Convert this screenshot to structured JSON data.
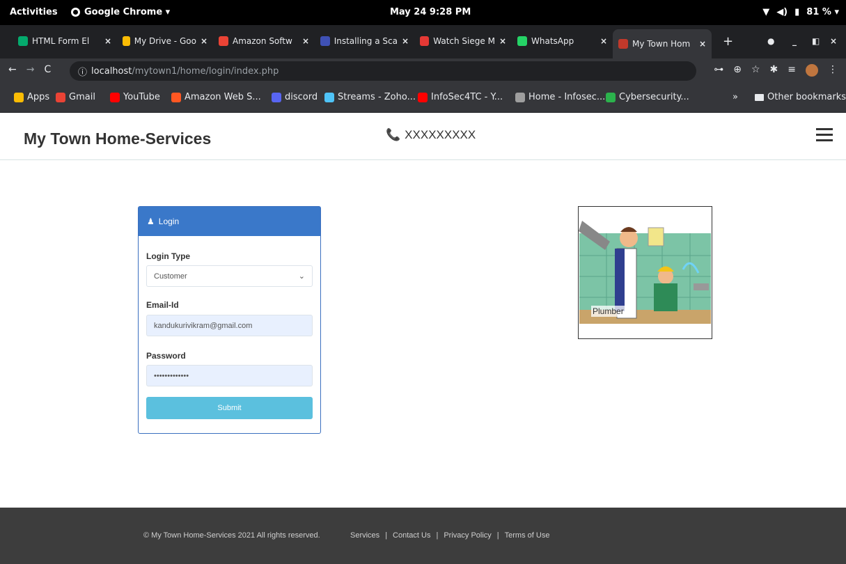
{
  "os_bar": {
    "activities": "Activities",
    "app_name": "Google Chrome ▾",
    "clock": "May 24  9:28 PM",
    "battery": "81 % ▾"
  },
  "browser": {
    "tabs": [
      {
        "label": "HTML Form El",
        "icon": "w3schools-icon",
        "color": "#04aa6d"
      },
      {
        "label": "My Drive - Goo",
        "icon": "drive-icon",
        "color": "#fbbc04"
      },
      {
        "label": "Amazon Softw",
        "icon": "gmail-icon",
        "color": "#ea4335"
      },
      {
        "label": "Installing a Sca",
        "icon": "shield-icon",
        "color": "#3f51b5"
      },
      {
        "label": "Watch Siege M",
        "icon": "red-x-icon",
        "color": "#e53935"
      },
      {
        "label": "WhatsApp",
        "icon": "whatsapp-icon",
        "color": "#25d366"
      },
      {
        "label": "My Town Hom",
        "icon": "site-icon",
        "color": "#c0392b"
      }
    ],
    "url_host": "localhost",
    "url_path": "/mytown1/home/login/index.php",
    "bookmarks": [
      {
        "label": "Apps",
        "icon": "apps-grid-icon",
        "color": "#fbbc04"
      },
      {
        "label": "Gmail",
        "icon": "gmail-icon",
        "color": "#ea4335"
      },
      {
        "label": "YouTube",
        "icon": "youtube-icon",
        "color": "#ff0000"
      },
      {
        "label": "Amazon Web S...",
        "icon": "aws-icon",
        "color": "#ff5722"
      },
      {
        "label": "discord",
        "icon": "discord-icon",
        "color": "#5865f2"
      },
      {
        "label": "Streams - Zoho...",
        "icon": "zoho-icon",
        "color": "#4fc3f7"
      },
      {
        "label": "InfoSec4TC - Y...",
        "icon": "youtube-icon",
        "color": "#ff0000"
      },
      {
        "label": "Home - Infosec...",
        "icon": "globe-icon",
        "color": "#9e9e9e"
      },
      {
        "label": "Cybersecurity...",
        "icon": "feedly-icon",
        "color": "#2bb24c"
      }
    ],
    "other_bookmarks": "Other bookmarks"
  },
  "site": {
    "brand": "My Town Home-Services",
    "phone": "XXXXXXXXX",
    "login": {
      "title": "Login",
      "type_label": "Login Type",
      "type_value": "Customer",
      "email_label": "Email-Id",
      "email_value": "kandukurivikram@gmail.com",
      "password_label": "Password",
      "password_value": "•••••••••••••",
      "submit": "Submit"
    },
    "service_caption": "Plumber",
    "footer": {
      "copyright": "© My Town Home-Services 2021 All rights reserved.",
      "links": [
        "Services",
        "Contact Us",
        "Privacy Policy",
        "Terms of Use"
      ]
    }
  }
}
